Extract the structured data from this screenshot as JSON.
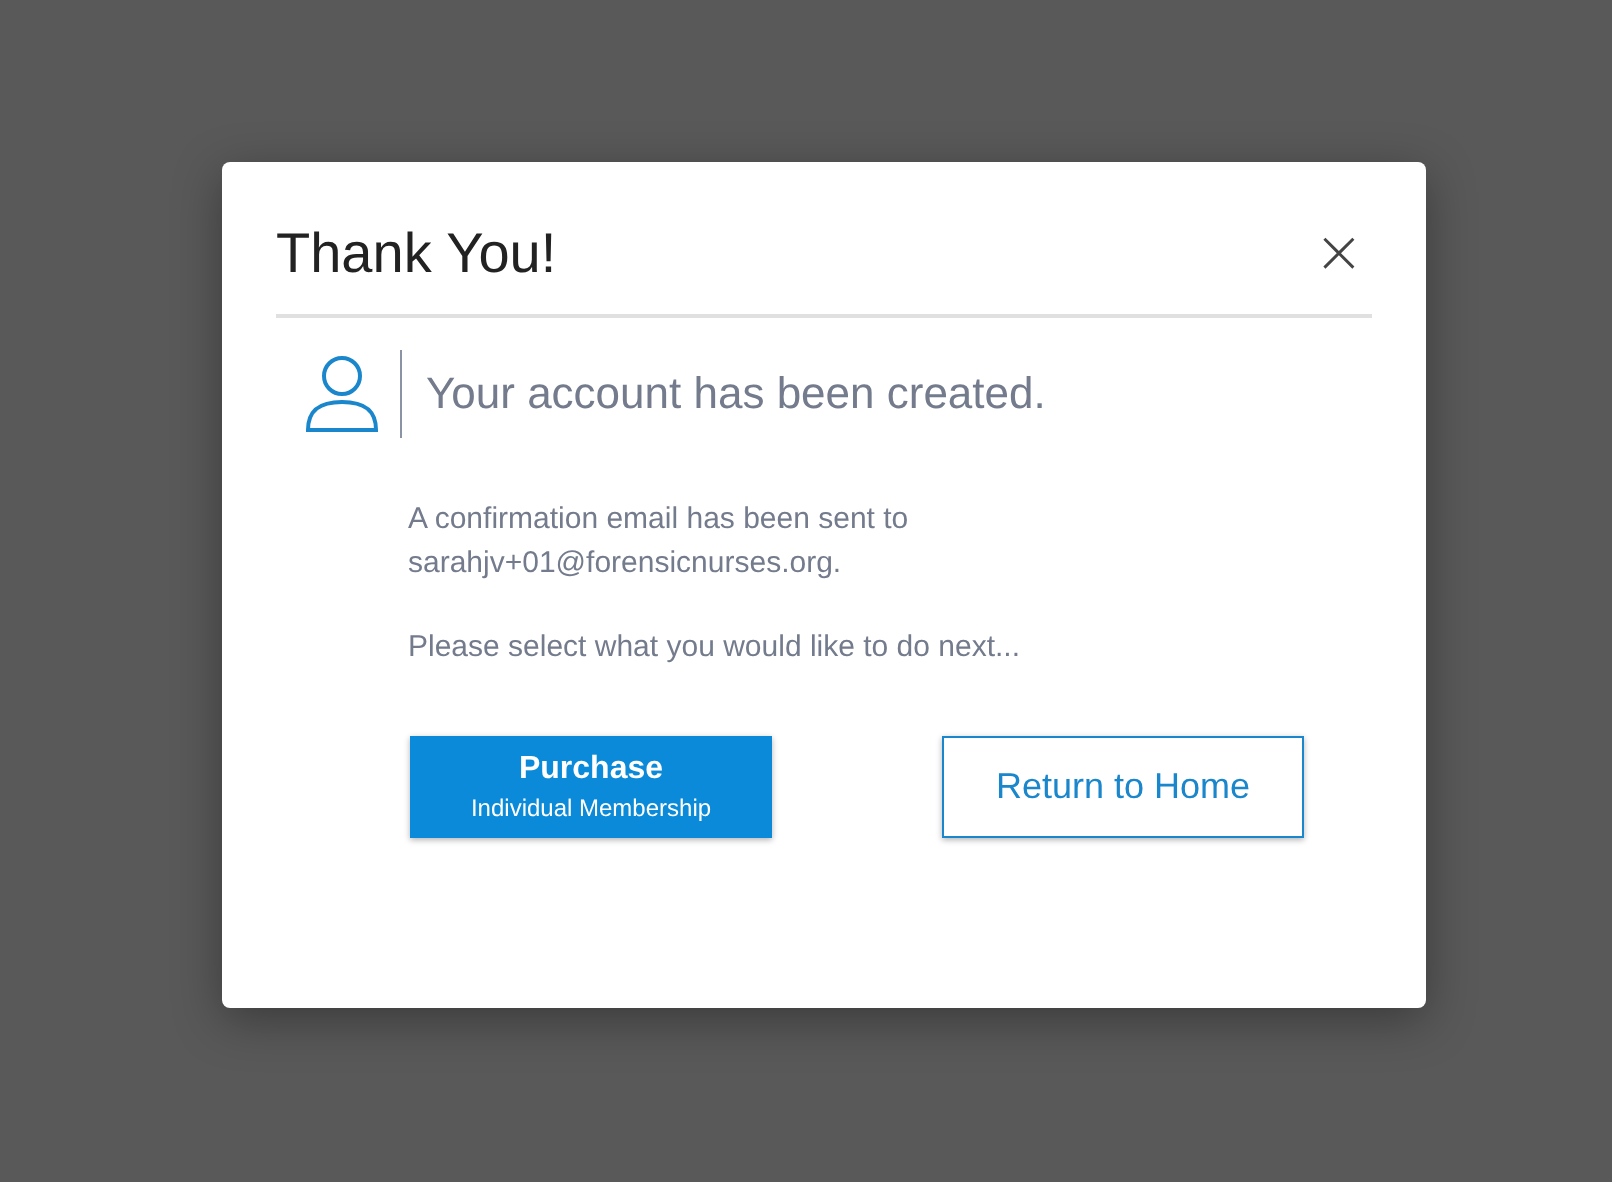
{
  "dialog": {
    "title": "Thank You!",
    "close": "×",
    "headline": "Your account has been created.",
    "message": "A confirmation email has been sent to sarahjv+01@forensicnurses.org.",
    "prompt": "Please select what you would like to do next...",
    "buttons": [
      {
        "kind": "primary",
        "label": "Purchase",
        "sublabel": "Individual Membership"
      },
      {
        "kind": "secondary",
        "label": "Return to Home"
      }
    ]
  }
}
